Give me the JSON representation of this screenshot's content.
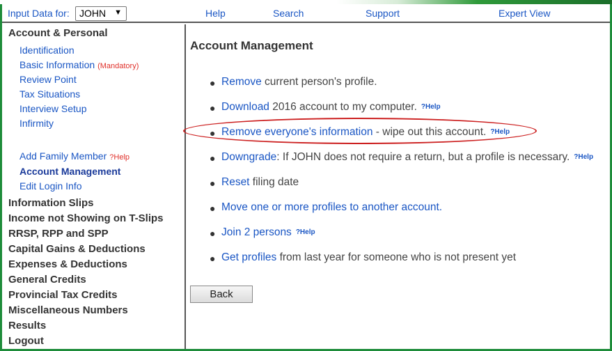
{
  "header": {
    "input_label": "Input Data for:",
    "person": "JOHN",
    "help": "Help",
    "search": "Search",
    "support": "Support",
    "expert_view": "Expert View"
  },
  "sidebar": {
    "account_section": "Account & Personal",
    "identification": "Identification",
    "basic_information": "Basic Information",
    "mandatory": "(Mandatory)",
    "review_point": "Review Point",
    "tax_situations": "Tax Situations",
    "interview_setup": "Interview Setup",
    "infirmity": "Infirmity",
    "add_family_member": "Add Family Member",
    "add_family_help": "?Help",
    "account_management": "Account Management",
    "edit_login_info": "Edit Login Info",
    "sections": [
      "Information Slips",
      "Income not Showing on T-Slips",
      "RRSP, RPP and SPP",
      "Capital Gains & Deductions",
      "Expenses & Deductions",
      "General Credits",
      "Provincial Tax Credits",
      "Miscellaneous Numbers",
      "Results",
      "Logout"
    ]
  },
  "main": {
    "title": "Account Management",
    "items": [
      {
        "link": "Remove",
        "text": " current person's profile.",
        "help": ""
      },
      {
        "link": "Download",
        "text": " 2016 account to my computer.",
        "help": "?Help"
      },
      {
        "link": "Remove everyone's information",
        "text": " - wipe out this account.",
        "help": "?Help"
      },
      {
        "link": "Downgrade",
        "text": ": If JOHN does not require a return, but a profile is necessary.",
        "help": "?Help"
      },
      {
        "link": "Reset",
        "text": " filing date",
        "help": ""
      },
      {
        "link": "Move one or more profiles to another account.",
        "text": "",
        "help": ""
      },
      {
        "link": "Join 2 persons",
        "text": "",
        "help": "?Help"
      },
      {
        "link": "Get profiles",
        "text": " from last year for someone who is not present yet",
        "help": ""
      }
    ],
    "back": "Back"
  }
}
